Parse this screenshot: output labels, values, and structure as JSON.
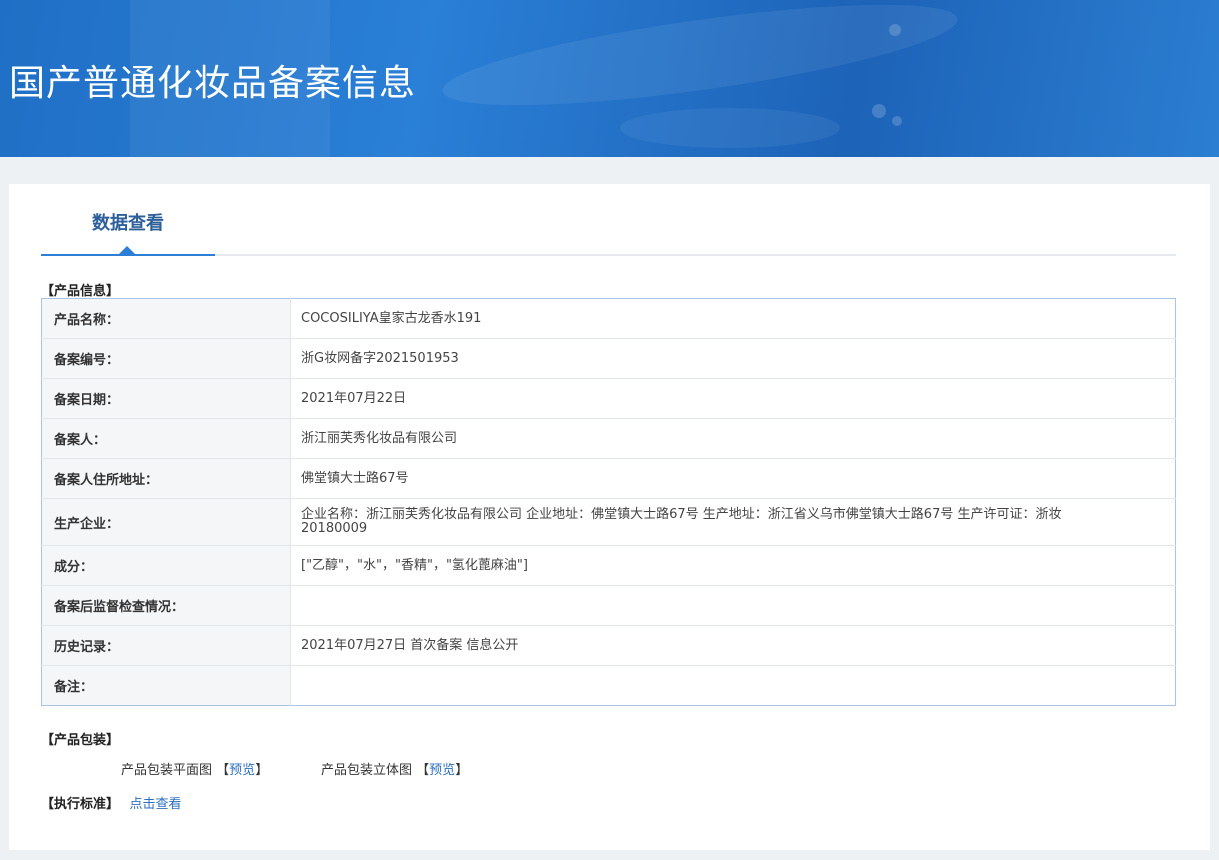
{
  "banner": {
    "title": "国产普通化妆品备案信息"
  },
  "tab": {
    "label": "数据查看"
  },
  "sections": {
    "product_info": "【产品信息】",
    "packaging": "【产品包装】",
    "standard": "【执行标准】"
  },
  "rows": [
    {
      "label": "产品名称：",
      "value": " COCOSILIYA皇家古龙香水191"
    },
    {
      "label": "备案编号：",
      "value": "浙G妆网备字2021501953"
    },
    {
      "label": "备案日期：",
      "value": "2021年07月22日"
    },
    {
      "label": "备案人：",
      "value": "浙江丽芙秀化妆品有限公司"
    },
    {
      "label": "备案人住所地址：",
      "value": "佛堂镇大士路67号"
    },
    {
      "label": "生产企业：",
      "value": "企业名称：浙江丽芙秀化妆品有限公司 企业地址：佛堂镇大士路67号 生产地址：浙江省义乌市佛堂镇大士路67号 生产许可证：浙妆20180009"
    },
    {
      "label": "成分：",
      "value": "[\"乙醇\"，\"水\"，\"香精\"，\"氢化蓖麻油\"]"
    },
    {
      "label": "备案后监督检查情况：",
      "value": ""
    },
    {
      "label": "历史记录：",
      "value": "2021年07月27日 首次备案 信息公开"
    },
    {
      "label": "备注：",
      "value": ""
    }
  ],
  "packaging": {
    "flat_label": "产品包装平面图",
    "flat_link": "预览",
    "stereo_label": "产品包装立体图",
    "stereo_link": "预览",
    "bracket_open": "【",
    "bracket_close": "】"
  },
  "standard": {
    "link": "点击查看"
  }
}
